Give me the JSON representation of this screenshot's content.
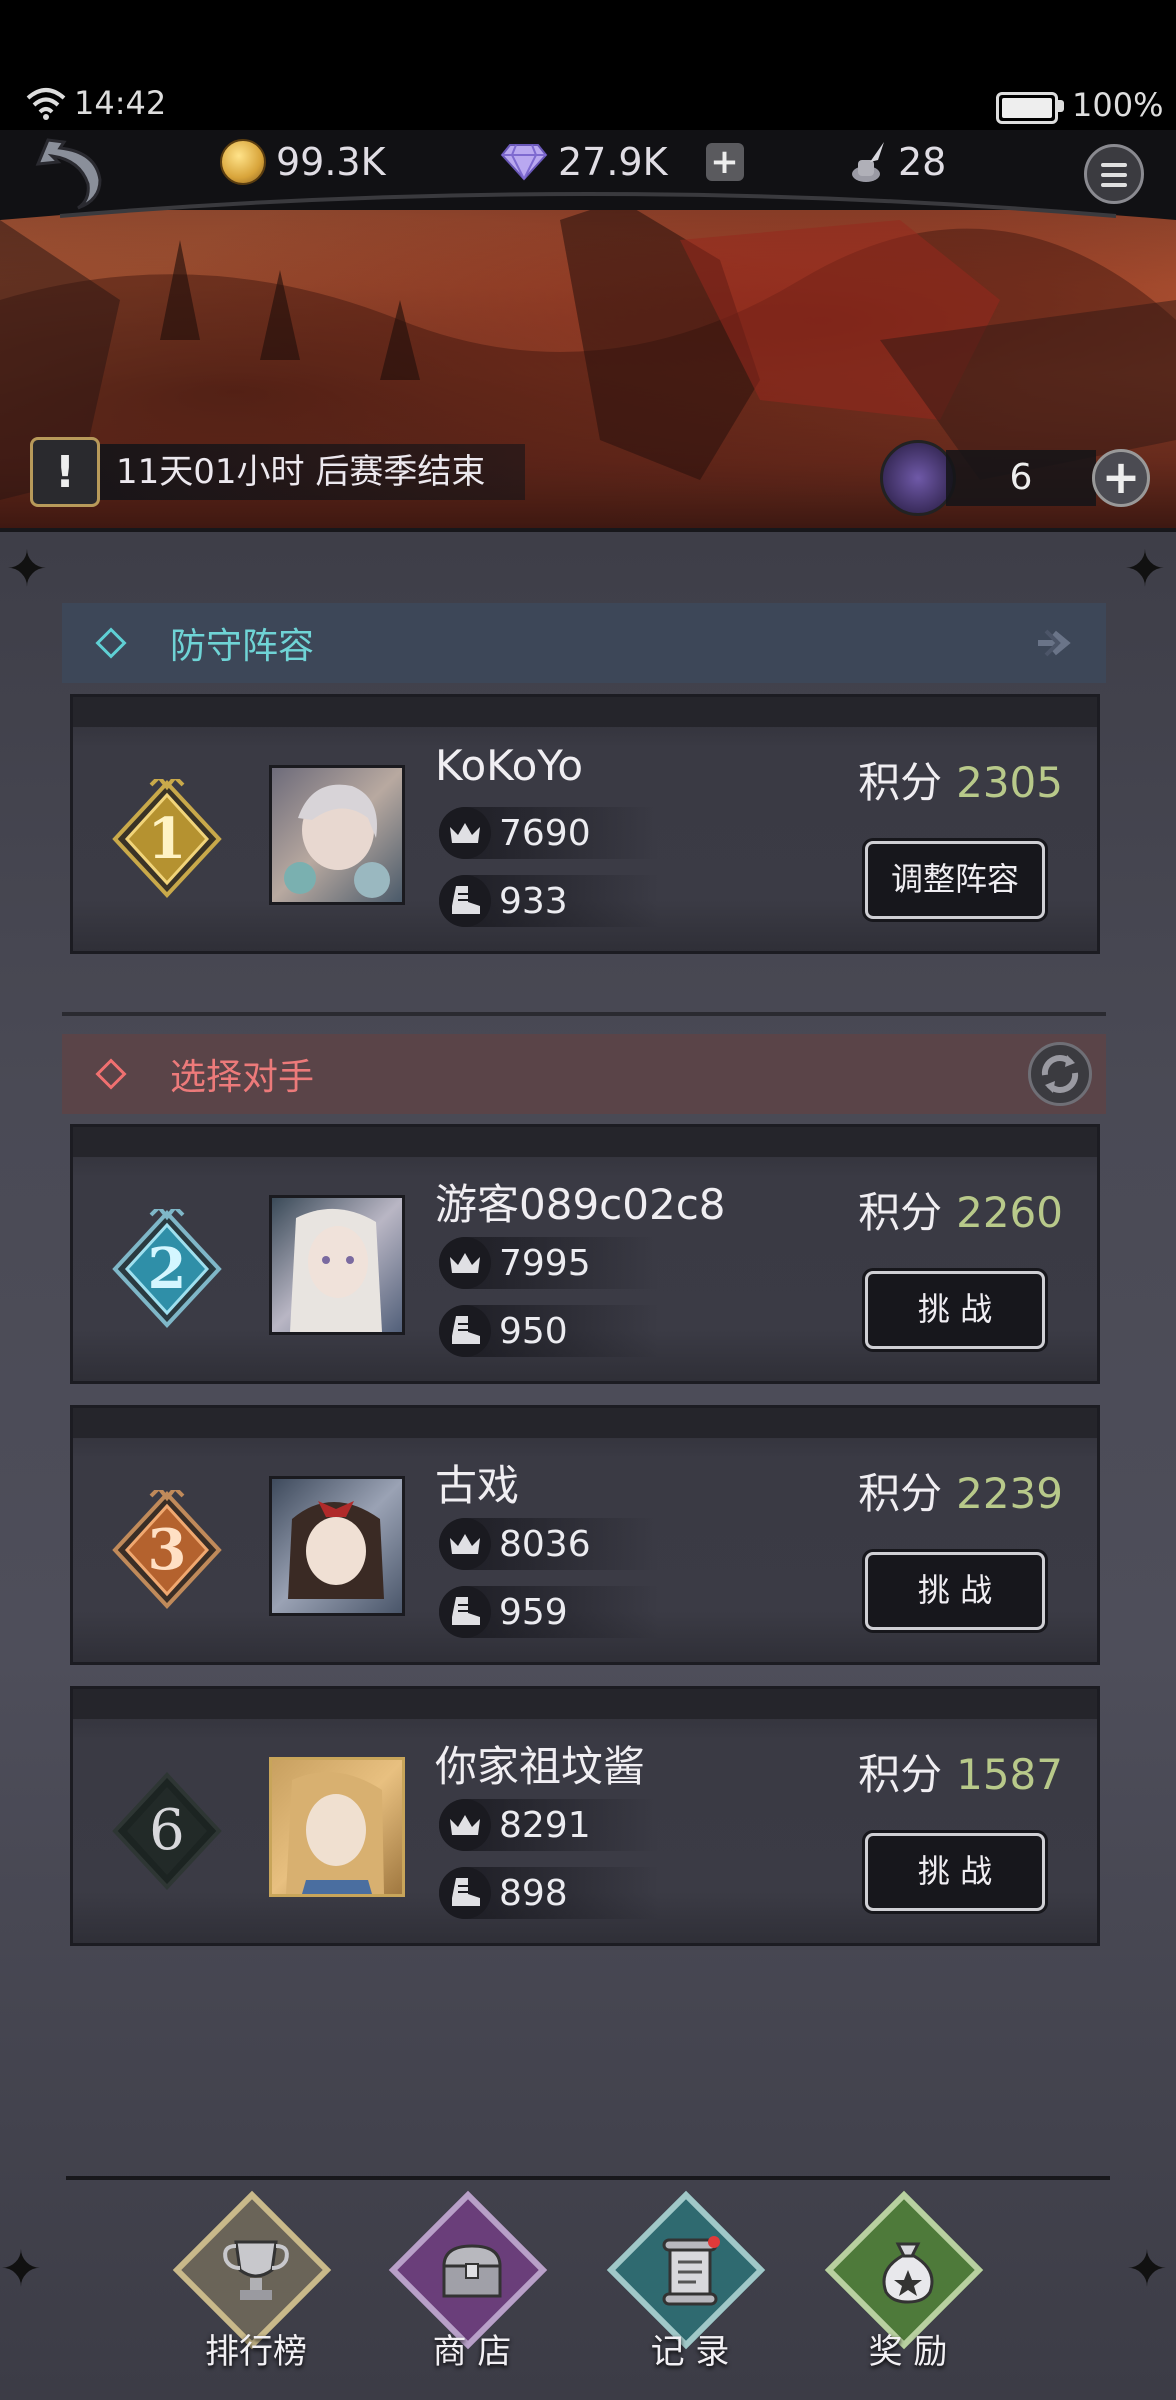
{
  "status_bar": {
    "time": "14:42",
    "battery": "100%"
  },
  "resources": {
    "gold": "99.3K",
    "gems": "27.9K",
    "ink": "28"
  },
  "season": {
    "countdown": "11天01小时 后赛季结束"
  },
  "tickets": {
    "count": "6"
  },
  "defense": {
    "section_title": "防守阵容",
    "card": {
      "rank": "1",
      "name": "KoKoYo",
      "power": "7690",
      "speed": "933",
      "score_label": "积分",
      "score": "2305",
      "button": "调整阵容"
    }
  },
  "opponents": {
    "section_title": "选择对手",
    "list": [
      {
        "rank": "2",
        "name": "游客089c02c8",
        "power": "7995",
        "speed": "950",
        "score_label": "积分",
        "score": "2260",
        "button": "挑 战"
      },
      {
        "rank": "3",
        "name": "古戏",
        "power": "8036",
        "speed": "959",
        "score_label": "积分",
        "score": "2239",
        "button": "挑 战"
      },
      {
        "rank": "6",
        "name": "你家祖坟酱",
        "power": "8291",
        "speed": "898",
        "score_label": "积分",
        "score": "1587",
        "button": "挑 战"
      }
    ]
  },
  "bottom_nav": [
    {
      "label": "排行榜",
      "icon": "trophy-icon"
    },
    {
      "label": "商 店",
      "icon": "treasure-chest-icon"
    },
    {
      "label": "记 录",
      "icon": "scroll-icon"
    },
    {
      "label": "奖 励",
      "icon": "reward-bag-icon"
    }
  ],
  "colors": {
    "defense_accent": "#6fd4d6",
    "opponent_accent": "#ec7a7a",
    "score_green": "#b8c98a",
    "rank1_gold": "#e8c45a",
    "rank2_cyan": "#58c9e0",
    "rank3_orange": "#e08a4a"
  }
}
